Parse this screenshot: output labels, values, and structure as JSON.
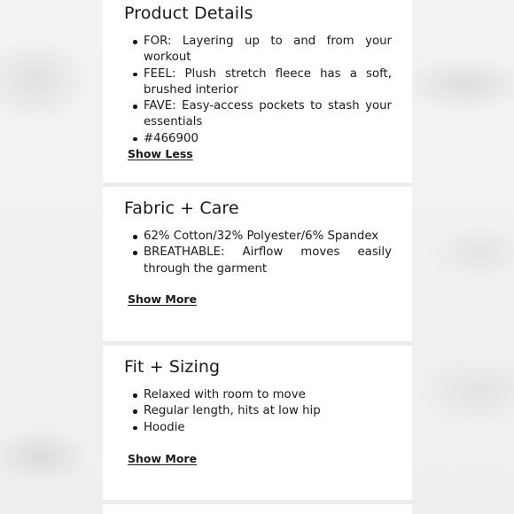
{
  "colors": {
    "text": "#1a1a1a",
    "card_background": "#ffffff",
    "divider": "#ececec"
  },
  "sections": [
    {
      "title": "Product Details",
      "bullets": [
        "FOR: Layering up to and from your workout",
        "FEEL: Plush stretch fleece has a soft, brushed interior",
        "FAVE: Easy-access pockets to stash your essentials",
        "#466900"
      ],
      "toggle_label": "Show Less"
    },
    {
      "title": "Fabric + Care",
      "bullets": [
        "62% Cotton/32% Polyester/6% Spandex",
        "BREATHABLE: Airflow moves easily through the garment"
      ],
      "toggle_label": "Show More"
    },
    {
      "title": "Fit + Sizing",
      "bullets": [
        "Relaxed with room to move",
        "Regular length, hits at low hip",
        "Hoodie"
      ],
      "toggle_label": "Show More"
    }
  ]
}
